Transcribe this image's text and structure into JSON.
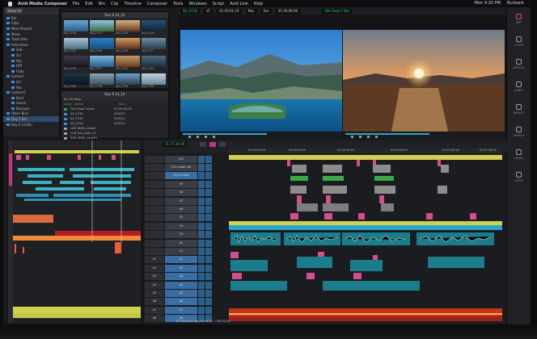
{
  "menubar": {
    "app": "Avid Media Composer",
    "items": [
      "File",
      "Edit",
      "Bin",
      "Clip",
      "Timeline",
      "Composer",
      "Tools",
      "Windows",
      "Script",
      "Avid Link",
      "Help"
    ],
    "clock": "Mon 9:20 PM",
    "user": "Burbank"
  },
  "project": {
    "view": "Show All",
    "tree": [
      "Bin",
      "Clips",
      "Most Shared",
      "Music",
      "Trash Bins",
      "Interviews",
      "Sub",
      "Scr",
      "Rec",
      "Diff",
      "Flats",
      "Cycles1",
      "Scr",
      "Rec",
      "Custom2",
      "Broll",
      "Genre",
      "Backups",
      "Other Bins",
      "Day 1 Bin",
      "Day 6 14 Bin"
    ]
  },
  "bins": {
    "thumbs_title": "Day 6 14_12",
    "thumbs": [
      "Sol_2716",
      "Sol_2717",
      "Sol_2718",
      "Sol_2719",
      "Sol_2722",
      "Sol_2724",
      "Sol_2726",
      "Sol_2727",
      "Sol_2734",
      "Sol_2737",
      "Sol_2741",
      "Sol_2744",
      "Sol_2755",
      "Sol_2756",
      "Sol_2758",
      "Sol_2759"
    ],
    "list_title": "Day 6 14_14",
    "list_subtitle": "Bin Mt Wide",
    "list_header": [
      "Color",
      "Name",
      "Start"
    ],
    "list_rows": [
      {
        "name": "Full Shoot Scene",
        "start": "01:00:00:00"
      },
      {
        "name": "04_2716",
        "start": "4/20/22"
      },
      {
        "name": "04_2720",
        "start": "4/20/22"
      },
      {
        "name": "Sh_0724",
        "start": "4/20/22"
      },
      {
        "name": "LXR 4B4K_code01",
        "start": ""
      },
      {
        "name": "1UK 4x4_code_01",
        "start": ""
      },
      {
        "name": "RDR 4B4K_code01",
        "start": ""
      }
    ]
  },
  "monitors": {
    "left_tc": "Dp_0718",
    "tc1": "V1",
    "tc2": "01:00:01:20",
    "tc3": "Mas",
    "tc4": "Dur",
    "tc5": "01:00:00:00",
    "right_tc": "SDL Road 1 Bot"
  },
  "timeline": {
    "tc_display": "01:27:26:08",
    "ruler": [
      "01:20:13:19",
      "01:20:15:19",
      "01:22:20:19",
      "01:24:55:13",
      "01:27:25:18",
      "01:27:28:19"
    ],
    "tracks": [
      {
        "a": "",
        "b": "V12"
      },
      {
        "a": "",
        "b": "V11 Lower 3rd"
      },
      {
        "a": "",
        "b": "V10 Credits"
      },
      {
        "a": "",
        "b": "V9"
      },
      {
        "a": "",
        "b": "V8"
      },
      {
        "a": "",
        "b": "V7"
      },
      {
        "a": "",
        "b": "V6"
      },
      {
        "a": "",
        "b": "V5"
      },
      {
        "a": "",
        "b": "V4"
      },
      {
        "a": "",
        "b": "V3"
      },
      {
        "a": "",
        "b": "V2"
      },
      {
        "a": "",
        "b": "V1"
      },
      {
        "a": "A1",
        "b": "A1"
      },
      {
        "a": "A2",
        "b": "A2"
      },
      {
        "a": "A3",
        "b": "A3"
      },
      {
        "a": "A4",
        "b": "A4"
      },
      {
        "a": "A5",
        "b": "A5"
      },
      {
        "a": "A6",
        "b": "A6"
      },
      {
        "a": "A7",
        "b": "A7"
      },
      {
        "a": "A8",
        "b": "A8"
      }
    ],
    "footer": "TC1: Trim on Lap (01:05:11 + 00:03:13)"
  },
  "right_tools": [
    "EDIT",
    "COLOR",
    "EFFECTS",
    "AUDIO",
    "PROJECT",
    "SEARCH",
    "MEDIA",
    "TOOLS"
  ],
  "colors": {
    "accent_pink": "#d24a8d",
    "accent_blue": "#2aa7c9",
    "playhead": "#ff6f2b"
  }
}
